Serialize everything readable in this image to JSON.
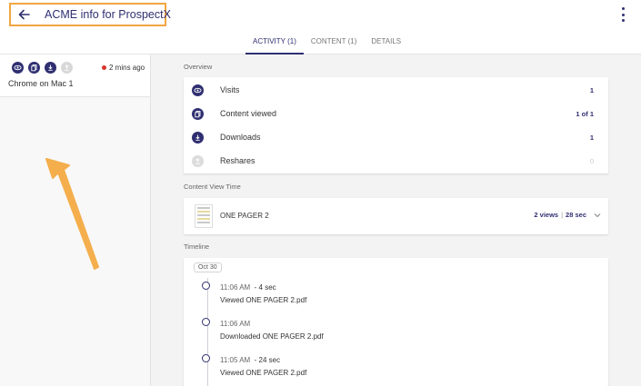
{
  "header": {
    "title": "ACME info for ProspectX"
  },
  "tabs": [
    {
      "label": "ACTIVITY (1)",
      "active": true
    },
    {
      "label": "CONTENT (1)",
      "active": false
    },
    {
      "label": "DETAILS",
      "active": false
    }
  ],
  "session": {
    "icons": [
      "eye-icon",
      "copy-icon",
      "download-icon",
      "share-icon"
    ],
    "time": "2 mins ago",
    "label": "Chrome on Mac 1"
  },
  "overview": {
    "label": "Overview",
    "rows": [
      {
        "name": "Visits",
        "value": "1",
        "icon": "eye-icon"
      },
      {
        "name": "Content viewed",
        "value": "1 of 1",
        "icon": "copy-icon"
      },
      {
        "name": "Downloads",
        "value": "1",
        "icon": "download-icon"
      },
      {
        "name": "Reshares",
        "value": "0",
        "icon": "share-icon"
      }
    ]
  },
  "content_view_time": {
    "label": "Content View Time",
    "name": "ONE PAGER 2",
    "views": "2 views",
    "separator": "|",
    "duration": "28 sec"
  },
  "timeline": {
    "label": "Timeline",
    "date": "Oct 30",
    "items": [
      {
        "time": "11:06 AM",
        "duration": "- 4 sec",
        "desc": "Viewed ONE PAGER 2.pdf"
      },
      {
        "time": "11:06 AM",
        "duration": "",
        "desc": "Downloaded ONE PAGER 2.pdf"
      },
      {
        "time": "11:05 AM",
        "duration": "- 24 sec",
        "desc": "Viewed ONE PAGER 2.pdf"
      }
    ]
  },
  "colors": {
    "accent": "#2f2f72",
    "highlight": "#f2a642",
    "live_dot": "#d9352b"
  }
}
